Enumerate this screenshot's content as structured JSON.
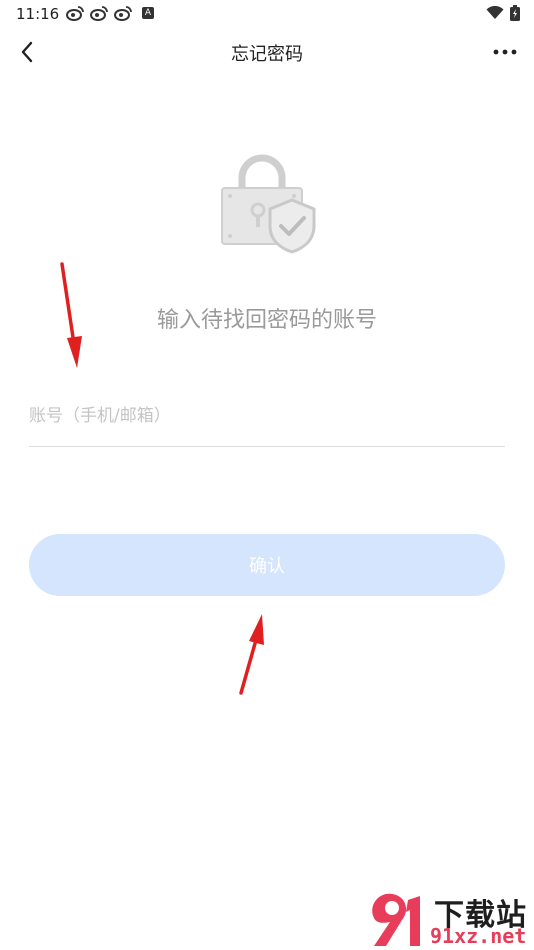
{
  "status_bar": {
    "time": "11:16",
    "icons_left": [
      "weibo-icon",
      "weibo-icon",
      "weibo-icon",
      "a-icon"
    ],
    "icon_a_text": "A",
    "icons_right": [
      "wifi-icon",
      "battery-charging-icon"
    ]
  },
  "header": {
    "title": "忘记密码",
    "back_icon": "chevron-left-icon",
    "more_icon": "more-dots-icon"
  },
  "main": {
    "illustration": "lock-shield-icon",
    "instruction": "输入待找回密码的账号",
    "account_input": {
      "value": "",
      "placeholder": "账号（手机/邮箱）"
    },
    "confirm_label": "确认",
    "confirm_bg": "#d4e5fd"
  },
  "watermark": {
    "line1": "下载站",
    "line2": "91xz.net"
  },
  "colors": {
    "annotation_arrow": "#e02020",
    "instruction_text": "#9a9a9a"
  }
}
